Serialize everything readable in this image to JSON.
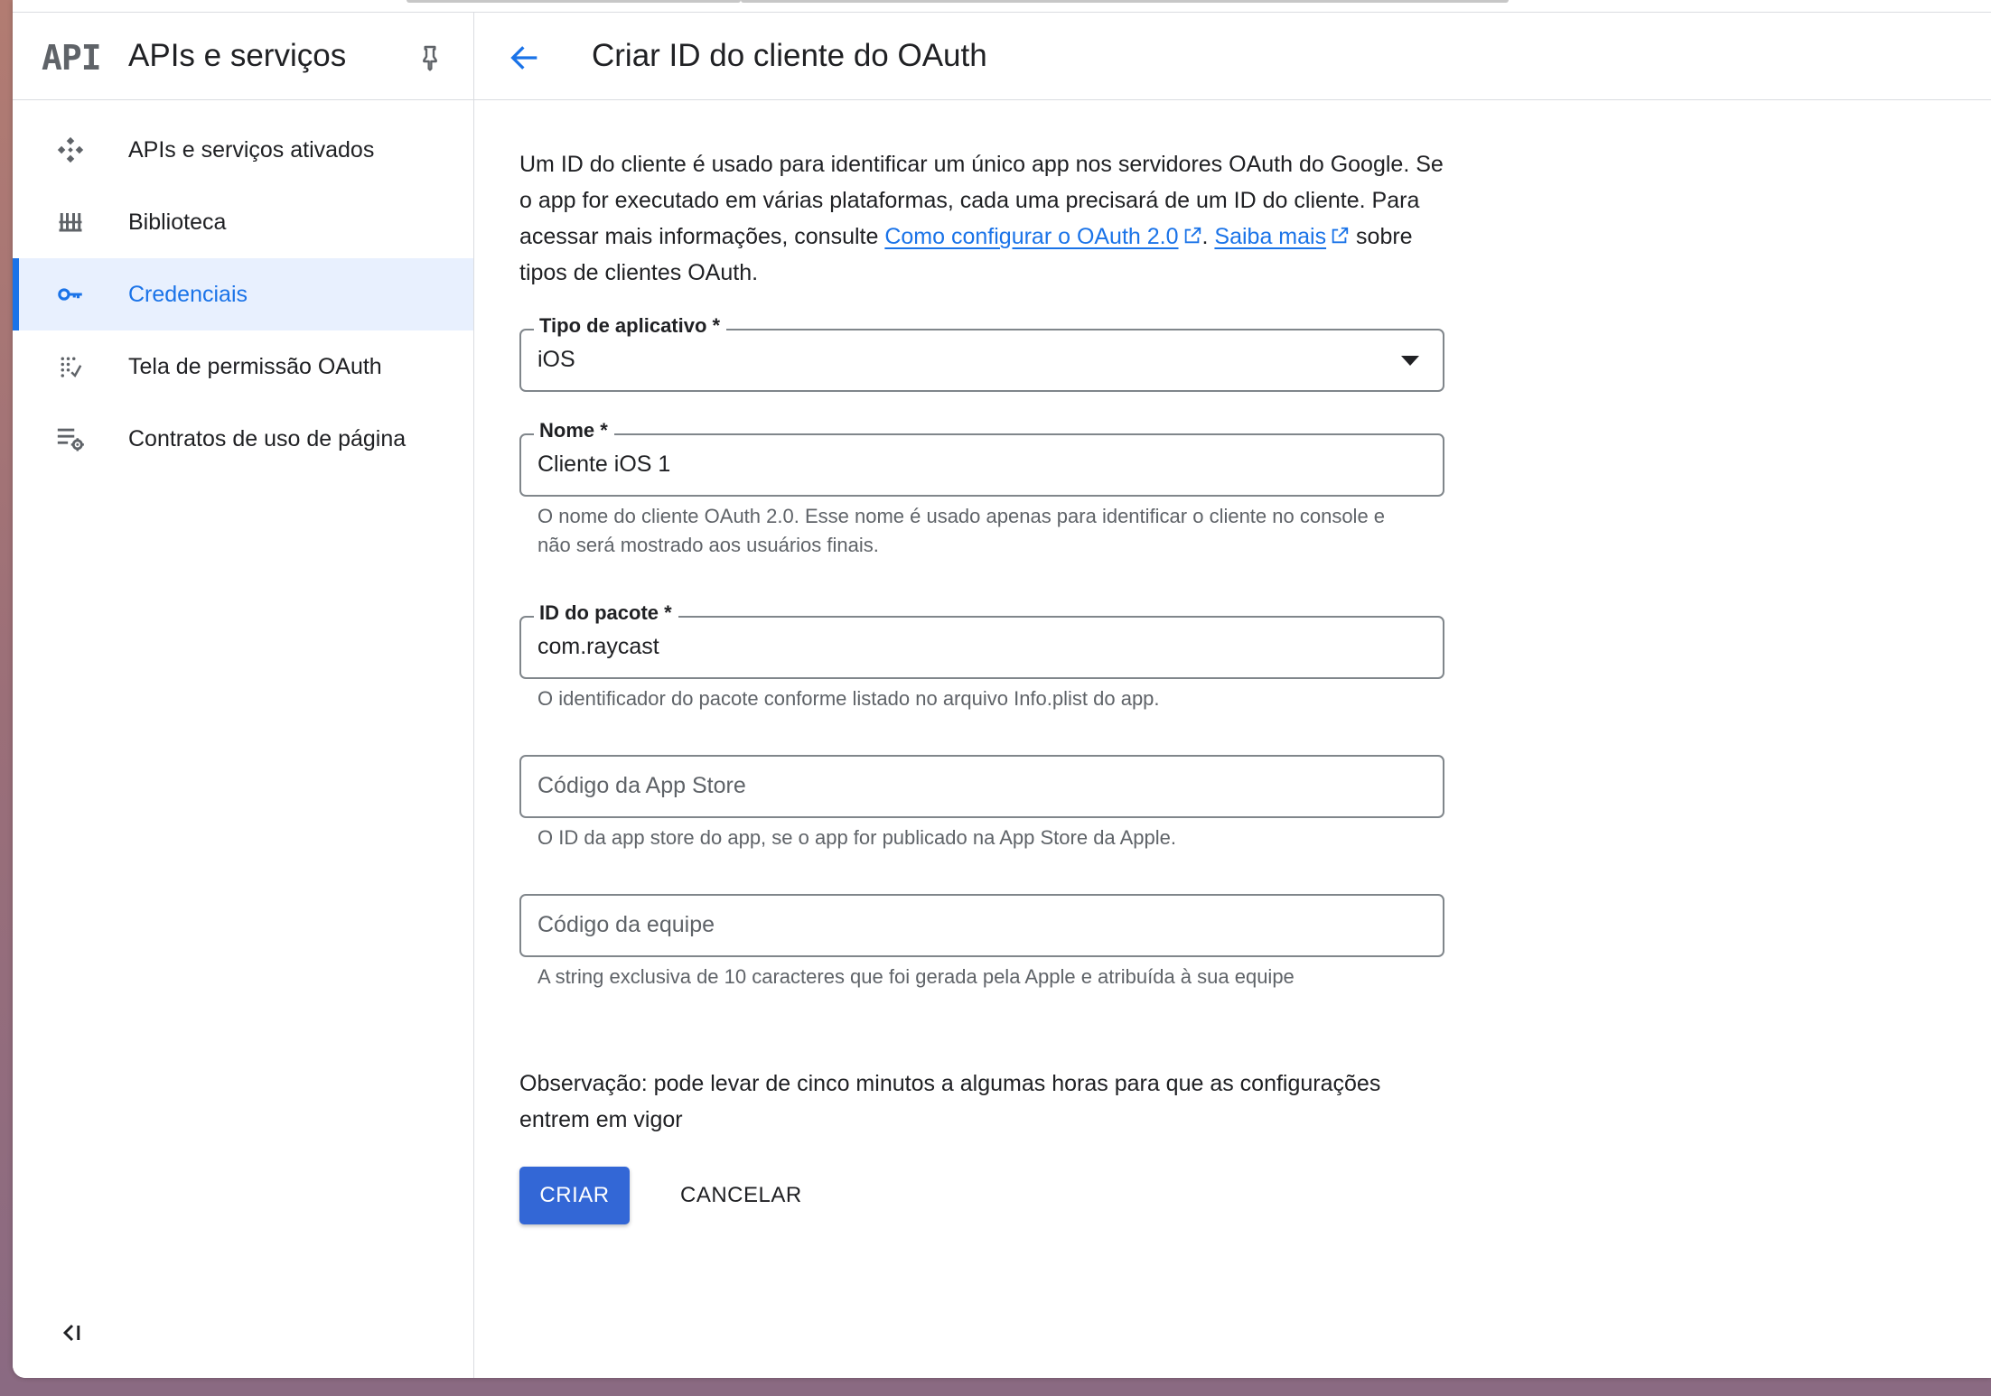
{
  "sidebar": {
    "logo_text": "API",
    "title": "APIs e serviços",
    "items": [
      {
        "label": "APIs e serviços ativados",
        "icon": "apis-diamond-icon",
        "active": false
      },
      {
        "label": "Biblioteca",
        "icon": "library-icon",
        "active": false
      },
      {
        "label": "Credenciais",
        "icon": "key-icon",
        "active": true
      },
      {
        "label": "Tela de permissão OAuth",
        "icon": "consent-screen-icon",
        "active": false
      },
      {
        "label": "Contratos de uso de página",
        "icon": "list-settings-icon",
        "active": false
      }
    ]
  },
  "header": {
    "title": "Criar ID do cliente do OAuth"
  },
  "intro": {
    "text_before": "Um ID do cliente é usado para identificar um único app nos servidores OAuth do Google. Se o app for executado em várias plataformas, cada uma precisará de um ID do cliente. Para acessar mais informações, consulte ",
    "link1": "Como configurar o OAuth 2.0",
    "separator": ". ",
    "link2": "Saiba mais",
    "text_after": " sobre tipos de clientes OAuth."
  },
  "form": {
    "app_type": {
      "label": "Tipo de aplicativo *",
      "value": "iOS"
    },
    "name": {
      "label": "Nome *",
      "value": "Cliente iOS 1",
      "hint": "O nome do cliente OAuth 2.0. Esse nome é usado apenas para identificar o cliente no console e não será mostrado aos usuários finais."
    },
    "bundle_id": {
      "label": "ID do pacote *",
      "value": "com.raycast",
      "hint": "O identificador do pacote conforme listado no arquivo Info.plist do app."
    },
    "app_store_id": {
      "placeholder": "Código da App Store",
      "hint": "O ID da app store do app, se o app for publicado na App Store da Apple."
    },
    "team_id": {
      "placeholder": "Código da equipe",
      "hint": "A string exclusiva de 10 caracteres que foi gerada pela Apple e atribuída à sua equipe"
    }
  },
  "note": "Observação: pode levar de cinco minutos a algumas horas para que as configurações entrem em vigor",
  "actions": {
    "create": "CRIAR",
    "cancel": "CANCELAR"
  },
  "colors": {
    "accent": "#1a73e8",
    "button": "#3367d6",
    "active_bg": "#e8f0fe"
  }
}
